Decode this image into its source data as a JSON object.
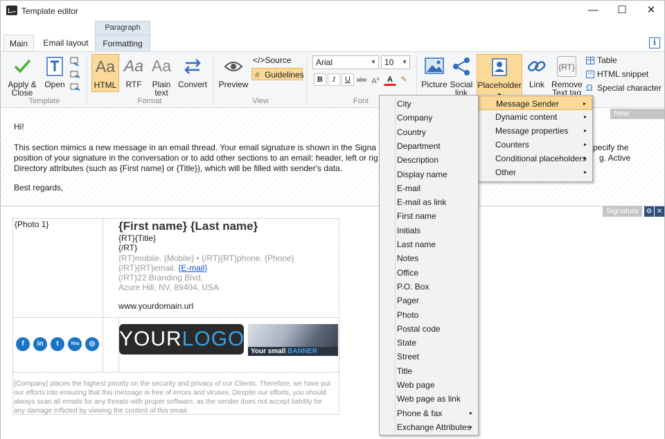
{
  "window": {
    "title": "Template editor",
    "minimize": "—",
    "maximize": "☐",
    "close": "✕"
  },
  "ribbon": {
    "context_tab": "Paragraph",
    "tabs": [
      "Main",
      "Email layout",
      "Formatting"
    ],
    "info": "i",
    "groups": {
      "template": "Template",
      "format": "Format",
      "view": "View",
      "font": "Font"
    },
    "buttons": {
      "apply_close": "Apply &\nClose",
      "open": "Open",
      "html": "HTML",
      "rtf": "RTF",
      "plain_text": "Plain\ntext",
      "convert": "Convert",
      "preview": "Preview",
      "source": "</>Source",
      "guidelines": "Guidelines",
      "picture": "Picture",
      "social_link": "Social\nlink",
      "placeholder": "Placeholder",
      "link": "Link",
      "remove_text_tag": "Remove\nText tag",
      "table": "Table",
      "html_snippet": "HTML snippet",
      "special_character": "Special character"
    },
    "font": {
      "family": "Arial",
      "size": "10",
      "bold": "B",
      "italic": "I",
      "underline": "U",
      "strike": "abc"
    },
    "icon_text": {
      "html": "Aa",
      "rtf": "Aa",
      "plain": "Aa",
      "rt": "{RT}"
    }
  },
  "message": {
    "tag": "New message",
    "greeting": "Hi!",
    "body_l1": "This section mimics a new message in an email thread. Your email signature is shown in the Signa",
    "body_l1b": "pecify the",
    "body_l2": "position of your signature in the conversation or to add other sections to an email: header, left or rig",
    "body_l2b": "g. Active",
    "body_l3": "Directory attributes (such as {First name} or {Title}), which will be filled with sender's data.",
    "regards": "Best regards,"
  },
  "signature": {
    "tag": "Signature",
    "photo": "{Photo 1}",
    "name": "{First name} {Last name}",
    "line_title": "{RT}{Title}",
    "line_rt": "{/RT}",
    "line_phone": "{RT}mobile. {Mobile} • {/RT}{RT}phone. {Phone}",
    "line_email_pre": "{/RT}{RT}email. ",
    "line_email_link": "{E-mail}",
    "line_addr1": "{/RT}22 Branding Blvd,",
    "line_addr2": "Azure Hill, NV, 89404, USA",
    "url": "www.yourdomain.url",
    "social": [
      "f",
      "in",
      "t",
      "You",
      "◎"
    ],
    "logo_a": "YOUR",
    "logo_b": "LOGO",
    "banner_a": "Your small ",
    "banner_b": "BANNER",
    "disclaimer": [
      "{Company} places the highest priority on the security and privacy of our Clients. Therefore, we have put",
      "our efforts into ensuring that this message is free of errors and viruses. Despite our efforts, you should",
      "always scan all emails for any threats with proper software, as the sender does not accept liability for",
      "any damage inflicted by viewing the content of this email."
    ]
  },
  "placeholder_menu": [
    "Message Sender",
    "Dynamic content",
    "Message properties",
    "Counters",
    "Conditional placeholders",
    "Other"
  ],
  "sender_menu": [
    "City",
    "Company",
    "Country",
    "Department",
    "Description",
    "Display name",
    "E-mail",
    "E-mail as link",
    "First name",
    "Initials",
    "Last name",
    "Notes",
    "Office",
    "P.O. Box",
    "Pager",
    "Photo",
    "Postal code",
    "State",
    "Street",
    "Title",
    "Web page",
    "Web page as link",
    "Phone & fax",
    "Exchange Attributes"
  ],
  "submenu_arrow": "▸"
}
